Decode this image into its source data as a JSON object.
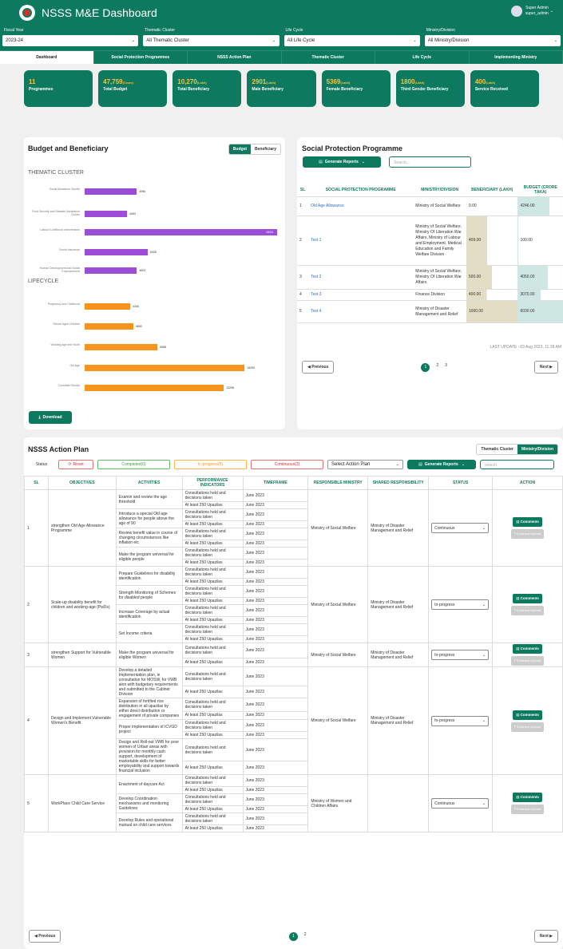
{
  "header": {
    "title": "NSSS M&E Dashboard",
    "user_name": "Super Admin",
    "user_id": "super_admin"
  },
  "filters": [
    {
      "label": "Fiscal Year",
      "value": "2023-24"
    },
    {
      "label": "Thematic Cluster",
      "value": "All Thematic Cluster"
    },
    {
      "label": "Life Cycle",
      "value": "All Life Cycle"
    },
    {
      "label": "Ministry/Division",
      "value": "All Ministry/Division"
    }
  ],
  "tabs": [
    "Dashboard",
    "Social Protection Programmes",
    "NSSS Action Plan",
    "Thematic Cluster",
    "Life Cycle",
    "Implementing Ministry"
  ],
  "cards": [
    {
      "value": "11",
      "unit": "",
      "label": "Programmes"
    },
    {
      "value": "47,759",
      "unit": "(Crore)",
      "label": "Total Budget"
    },
    {
      "value": "10,270",
      "unit": "(Lakh)",
      "label": "Total Beneficiary"
    },
    {
      "value": "2901",
      "unit": "(Lakh)",
      "label": "Male Beneficiary"
    },
    {
      "value": "5369",
      "unit": "(Lakh)",
      "label": "Female Beneficiary"
    },
    {
      "value": "1800",
      "unit": "(Lakh)",
      "label": "Third Gender Beneficiary"
    },
    {
      "value": "400",
      "unit": "(Lakh)",
      "label": "Service Received"
    }
  ],
  "budget_panel": {
    "title": "Budget and Beneficiary",
    "toggle": [
      "Budget",
      "Beneficiary"
    ],
    "section1": "THEMATIC CLUSTER",
    "section2": "LIFECYCLE",
    "download": "Download"
  },
  "chart_data": [
    {
      "type": "bar",
      "orientation": "horizontal",
      "categories": [
        "Social Allowance Cluster",
        "Food Security and Disaster Assistance Cluster",
        "Labour/ Livelihood Interventions",
        "Social Insurance",
        "Human Development and Social Empowerment"
      ],
      "values": [
        4996,
        4053,
        18411,
        6028,
        5003
      ],
      "color": "#9c4dd6"
    },
    {
      "type": "bar",
      "orientation": "horizontal",
      "categories": [
        "Pregnancy and Childhood",
        "School Aged Children",
        "Working Age and Youth",
        "Old Age",
        "Covariate Shocks"
      ],
      "values": [
        4346,
        4650,
        6968,
        15299,
        13298
      ],
      "color": "#f7941d"
    }
  ],
  "sp": {
    "title": "Social Protection Programme",
    "generate": "Generate Reports",
    "search_placeholder": "Search...",
    "headers": [
      "SL",
      "SOCIAL PROTECTION PROGRAMME",
      "MINISTRY/DIVISION",
      "BENEFICIARY (LAKH)",
      "BUDGET (CRORE TAKA)"
    ],
    "rows": [
      {
        "sl": "1",
        "name": "Old Age Allowance",
        "ministry": "Ministry of Social Welfare",
        "ben": "0.00",
        "bud": "4246.00"
      },
      {
        "sl": "2",
        "name": "Test 1",
        "ministry": "Ministry of Social Welfare, Ministry Of Liberation War Affairs, Ministry of Labour and Employment, Medical Education and Family Welfare Division",
        "ben": "409.00",
        "bud": "100.00"
      },
      {
        "sl": "3",
        "name": "Test 2",
        "ministry": "Ministry of Social Welfare, Ministry Of Liberation War Affairs",
        "ben": "500.00",
        "bud": "4050.00"
      },
      {
        "sl": "4",
        "name": "Test 3",
        "ministry": "Finance Division",
        "ben": "400.00",
        "bud": "3070.00"
      },
      {
        "sl": "5",
        "name": "Test 4",
        "ministry": "Ministry of Disaster Management and Relief",
        "ben": "1000.00",
        "bud": "6030.00"
      }
    ],
    "last_update": "LAST UPDATE : 03 Aug 2023, 11:39 AM",
    "prev": "Previous",
    "next": "Next",
    "pages": [
      "1",
      "2",
      "3"
    ]
  },
  "ap": {
    "title": "NSSS Action Plan",
    "toggle": [
      "Thematic Cluster",
      "Ministry/Division"
    ],
    "status_label": "Status",
    "reset": "Reset",
    "completed": "Completed(0)",
    "inprogress": "In-progress(6)",
    "continuous": "Continuous(3)",
    "select": "Select Action Plan",
    "generate": "Generate Reports",
    "search": "search",
    "headers": [
      "SL",
      "OBJECTIVES",
      "ACTIVITIES",
      "PERFORMANCE INDICATORS",
      "TIMEFRAME",
      "RESPONSIBLE MINISTRY",
      "SHARED RESPONSIBILITY",
      "STATUS",
      "ACTION"
    ],
    "comments": "Comments",
    "evidence": "Evidence Upload",
    "groups": [
      {
        "sl": "1",
        "objective": "strengthen Old Age Allowance Programme",
        "ministry": "Ministry of Social Welfare",
        "shared": "Ministry of Disaster Management and Relief",
        "status": "Continuous",
        "acts": [
          {
            "a": "Examin and review the age threshold",
            "p": [
              "Consultations held and decisions taken",
              "At least 250 Upazilas"
            ]
          },
          {
            "a": "Introduce a special Old age allowance for people above the age of 90",
            "p": [
              "Consultations held and decisions taken",
              "At least 250 Upazilas"
            ]
          },
          {
            "a": "Review benefit value in course of changing circumstances like inflation etc",
            "p": [
              "Consultations held and decisions taken",
              "At least 250 Upazilas"
            ]
          },
          {
            "a": "Make the program universal for eligible people",
            "p": [
              "Consultations held and decisions taken",
              "At least 250 Upazilas"
            ]
          }
        ]
      },
      {
        "sl": "2",
        "objective": "Scale-up disability benefit for children and working-age (PwDs)",
        "ministry": "Ministry of Social Welfare",
        "shared": "Ministry of Disaster Management and Relief",
        "status": "In-progress",
        "acts": [
          {
            "a": "Prepare Guidelines for disability identification",
            "p": [
              "Consultations held and decisions taken",
              "At least 250 Upazilas"
            ]
          },
          {
            "a": "Strength Monitoring of Schemes for disabled people",
            "p": [
              "Consultations held and decisions taken",
              "At least 250 Upazilas"
            ]
          },
          {
            "a": "Increase Coverage by actual identification",
            "p": [
              "Consultations held and decisions taken",
              "At least 250 Upazilas"
            ]
          },
          {
            "a": "Set Income criteria",
            "p": [
              "Consultations held and decisions taken",
              "At least 250 Upazilas"
            ]
          }
        ]
      },
      {
        "sl": "3",
        "objective": "strengthen Support for Vulnerable Women",
        "ministry": "Ministry of Social Welfare",
        "shared": "Ministry of Disaster Management and Relief",
        "status": "In-progress",
        "acts": [
          {
            "a": "Make the program universal for eligible Women",
            "p": [
              "Consultations held and decisions taken",
              "At least 250 Upazilas"
            ]
          }
        ]
      },
      {
        "sl": "4",
        "objective": "Design and Implement Vulnerable Women's Benefit",
        "ministry": "Ministry of Social Welfare",
        "shared": "Ministry of Disaster Management and Relief",
        "status": "In-progress",
        "acts": [
          {
            "a": "Develop a detailed Implementation plan, in consultation for MOSW, for VWB alon with budgetary requirements and submitted to the Cabinet Division",
            "p": [
              "Consultations held and decisions taken",
              "At least 250 Upazilas"
            ]
          },
          {
            "a": "Expansion of fortified rice distribution in all upazilas by either direct distribution or engagement of private companies",
            "p": [
              "Consultations held and decisions taken",
              "At least 250 Upazilas"
            ]
          },
          {
            "a": "Proper implementation of ICVGD project",
            "p": [
              "Consultations held and decisions taken",
              "At least 250 Upazilas"
            ]
          },
          {
            "a": "Design and Roll-out VWB for poor women of Urban areas with provision for monthly cash support, development of marketable skills for better employability and support towards financial inclusion",
            "p": [
              "Consultations held and decisions taken",
              "At least 250 Upazilas"
            ]
          }
        ]
      },
      {
        "sl": "5",
        "objective": "WorkPlace Child Care Service",
        "ministry": "Ministry of Women and Children Affairs",
        "shared": "",
        "status": "Continuous",
        "acts": [
          {
            "a": "Enactment of daycare Act",
            "p": [
              "Consultations held and decisions taken",
              "At least 250 Upazilas"
            ]
          },
          {
            "a": "Develop Coordination mechanisms and monitoring Guidelines",
            "p": [
              "Consultations held and decisions taken",
              "At least 250 Upazilas"
            ]
          },
          {
            "a": "Develop Rules and operational manual on child care services",
            "p": [
              "Consultations held and decisions taken",
              "At least 250 Upazilas"
            ]
          }
        ]
      }
    ],
    "timeframe": "June 2023",
    "prev": "Previous",
    "next": "Next",
    "pages": [
      "1",
      "2"
    ]
  }
}
